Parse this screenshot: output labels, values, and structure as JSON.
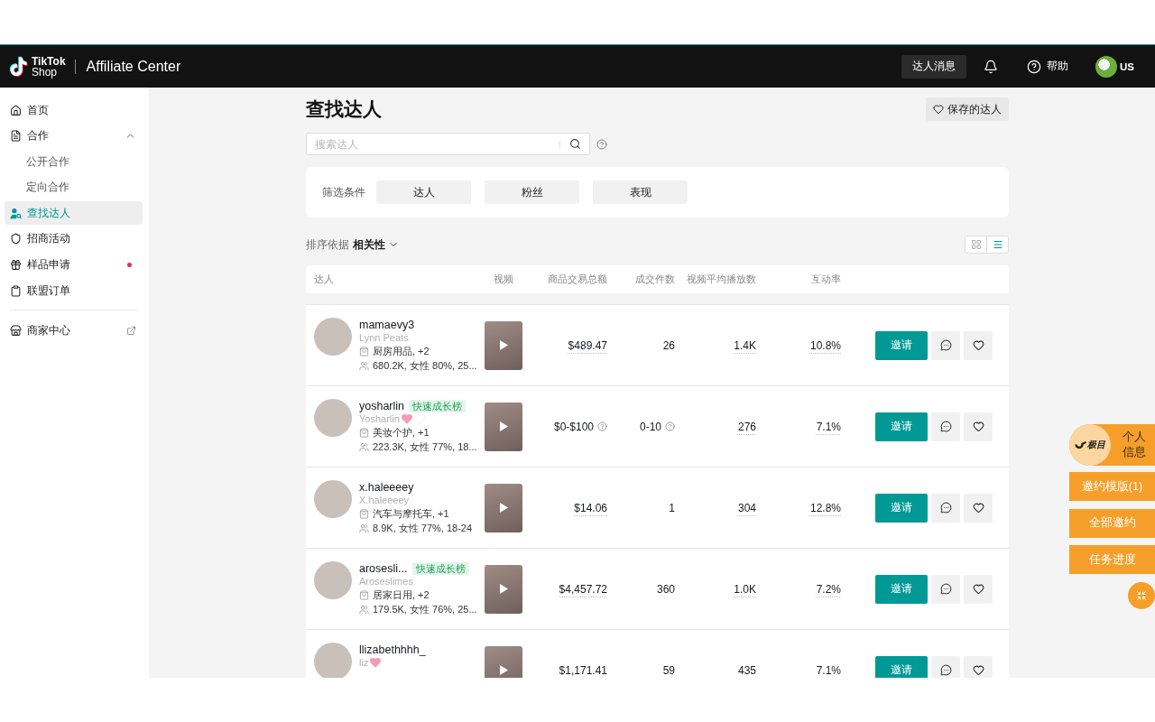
{
  "header": {
    "logo": {
      "line_1": "TikTok",
      "line_2": "Shop"
    },
    "title": "Affiliate Center",
    "messages_button": "达人消息",
    "help_label": "帮助",
    "account_label": "US"
  },
  "sidebar": {
    "items": [
      {
        "label": "首页",
        "selected": false,
        "dot": false
      },
      {
        "label": "合作",
        "selected": false,
        "dot": false,
        "expanded": true,
        "children": [
          {
            "label": "公开合作",
            "selected": false
          },
          {
            "label": "定向合作",
            "selected": false
          }
        ]
      },
      {
        "label": "查找达人",
        "selected": true,
        "dot": false
      },
      {
        "label": "招商活动",
        "selected": false,
        "dot": false
      },
      {
        "label": "样品申请",
        "selected": false,
        "dot": true
      },
      {
        "label": "联盟订单",
        "selected": false,
        "dot": false
      }
    ],
    "footer_items": [
      {
        "label": "商家中心",
        "selected": false,
        "external": true
      }
    ]
  },
  "page": {
    "title": "查找达人",
    "saved_button": "保存的达人",
    "search": {
      "placeholder": "搜索达人"
    },
    "filters": {
      "label": "筛选条件",
      "buttons": [
        "达人",
        "粉丝",
        "表现"
      ]
    },
    "sort": {
      "label": "排序依据",
      "value": "相关性"
    },
    "view_modes": [
      {
        "selected": false
      },
      {
        "selected": true
      }
    ]
  },
  "table": {
    "columns": [
      "达人",
      "视频",
      "商品交易总额",
      "成交件数",
      "视频平均播放数",
      "互动率"
    ],
    "rows": [
      {
        "name": "mamaevy3",
        "nickname": "Lynn Peats",
        "category": "厨房用品, +2",
        "audience": "680.2K, 女性 80%, 25...",
        "gmv": {
          "text": "$489.47",
          "hint": false
        },
        "units": {
          "text": "26",
          "hint": false
        },
        "avg_views": "1.4K",
        "engagement": "10.8%",
        "invite_label": "邀请"
      },
      {
        "name": "yosharlin",
        "tag": "快速成长榜",
        "nickname": "Yosharlin",
        "nickname_hearts": [
          {
            "color": "#f59ab8"
          },
          {
            "color": "#ffffff"
          }
        ],
        "category": "美妆个护, +1",
        "audience": "223.3K, 女性 77%, 18...",
        "gmv": {
          "text": "$0-$100",
          "hint": true
        },
        "units": {
          "text": "0-10",
          "hint": true
        },
        "avg_views": "276",
        "engagement": "7.1%",
        "invite_label": "邀请"
      },
      {
        "name": "x.haleeeey",
        "nickname": "X.haleeeey",
        "category": "汽车与摩托车, +1",
        "audience": "8.9K, 女性 77%, 18-24",
        "gmv": {
          "text": "$14.06",
          "hint": false
        },
        "units": {
          "text": "1",
          "hint": false
        },
        "avg_views": "304",
        "engagement": "12.8%",
        "invite_label": "邀请"
      },
      {
        "name": "arosesli...",
        "tag": "快速成长榜",
        "nickname": "Aroseslimes",
        "category": "居家日用, +2",
        "audience": "179.5K, 女性 76%, 25...",
        "gmv": {
          "text": "$4,457.72",
          "hint": false
        },
        "units": {
          "text": "360",
          "hint": false
        },
        "avg_views": "1.0K",
        "engagement": "7.2%",
        "invite_label": "邀请"
      },
      {
        "name": "llizabethhhh_",
        "nickname": "liz",
        "nickname_hearts": [
          {
            "color": "#f59ab8"
          }
        ],
        "gmv": {
          "text": "$1,171.41",
          "hint": false
        },
        "units": {
          "text": "59",
          "hint": false
        },
        "avg_views": "435",
        "engagement": "7.1%",
        "invite_label": "邀请"
      }
    ]
  },
  "side_panel": {
    "profile_tab": {
      "logo_text": "极目",
      "label": "个人信息"
    },
    "buttons": [
      "邀约模版(1)",
      "全部邀约",
      "任务进度"
    ]
  }
}
